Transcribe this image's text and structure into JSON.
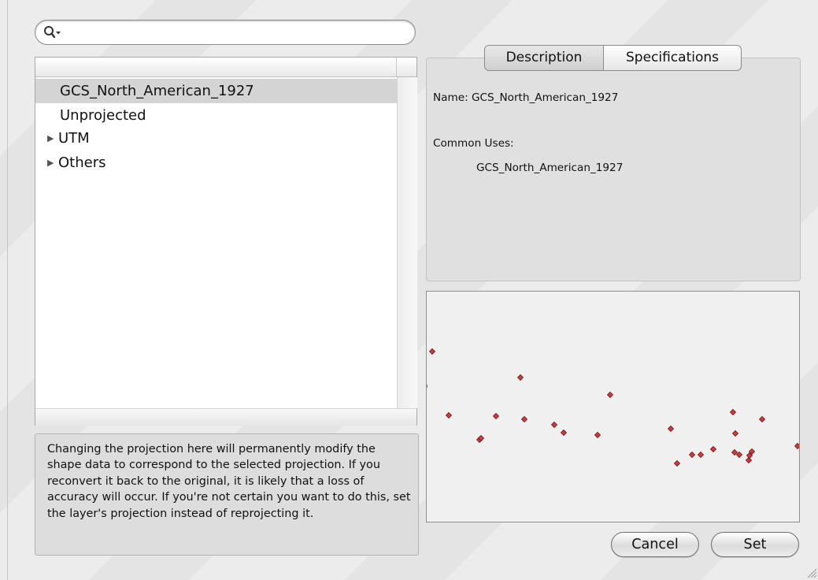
{
  "search": {
    "value": "",
    "placeholder": ""
  },
  "tree": {
    "items": [
      {
        "label": "GCS_North_American_1927",
        "selected": true,
        "expandable": false
      },
      {
        "label": "Unprojected",
        "selected": false,
        "expandable": false
      },
      {
        "label": "UTM",
        "selected": false,
        "expandable": true
      },
      {
        "label": "Others",
        "selected": false,
        "expandable": true
      }
    ]
  },
  "info_text": "Changing the projection here will permanently modify the shape data to correspond to the selected projection.  If you reconvert it back to the original, it is likely that a loss of accuracy will occur. If you're not certain you want to do this, set the layer's projection instead of reprojecting it.",
  "tabs": [
    {
      "label": "Description",
      "selected": true
    },
    {
      "label": "Specifications",
      "selected": false
    }
  ],
  "description": {
    "name_line": "Name: GCS_North_American_1927",
    "common_uses_label": "Common Uses:",
    "common_uses_value": "GCS_North_American_1927"
  },
  "buttons": {
    "cancel": "Cancel",
    "set": "Set"
  },
  "colors": {
    "point_fill": "#d43a3a",
    "point_stroke": "#6a1010",
    "selection": "#d4d4d4"
  }
}
